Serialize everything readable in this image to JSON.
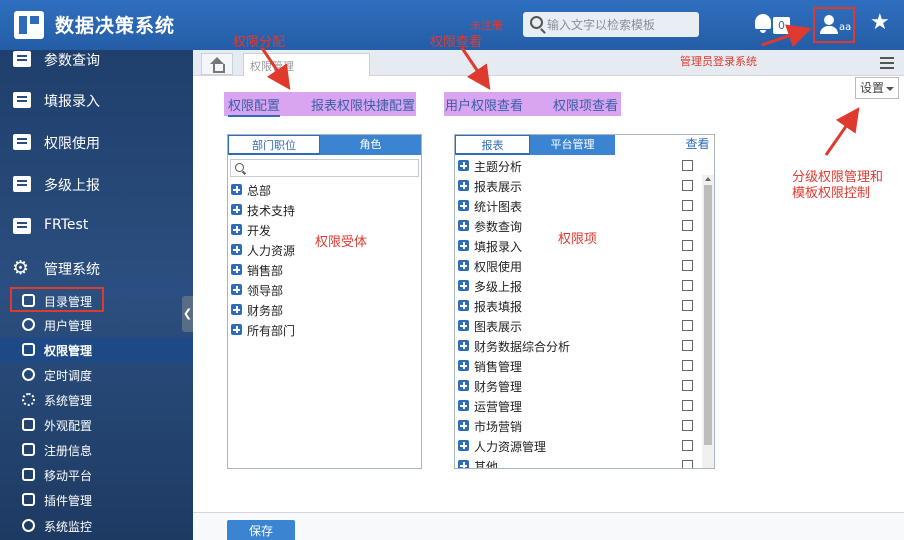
{
  "header": {
    "app_title": "数据决策系统",
    "search_placeholder": "输入文字以检索模板",
    "notification_count": "0",
    "user_name": "aa"
  },
  "sidebar": {
    "items": [
      {
        "label": "参数查询",
        "icon": "report-icon"
      },
      {
        "label": "填报录入",
        "icon": "report-icon"
      },
      {
        "label": "权限使用",
        "icon": "report-icon"
      },
      {
        "label": "多级上报",
        "icon": "report-icon"
      },
      {
        "label": "FRTest",
        "icon": "report-icon"
      },
      {
        "label": "管理系统",
        "icon": "gear-icon"
      }
    ],
    "sub_items": [
      {
        "label": "目录管理",
        "icon": "directory-icon"
      },
      {
        "label": "用户管理",
        "icon": "user-icon"
      },
      {
        "label": "权限管理",
        "icon": "lock-icon",
        "active": true
      },
      {
        "label": "定时调度",
        "icon": "clock-icon"
      },
      {
        "label": "系统管理",
        "icon": "gear-icon"
      },
      {
        "label": "外观配置",
        "icon": "palette-icon"
      },
      {
        "label": "注册信息",
        "icon": "register-icon"
      },
      {
        "label": "移动平台",
        "icon": "mobile-icon"
      },
      {
        "label": "插件管理",
        "icon": "plugin-icon"
      },
      {
        "label": "系统监控",
        "icon": "monitor-icon"
      }
    ]
  },
  "content": {
    "page_tab": "权限管理",
    "settings_label": "设置",
    "tabs_left": [
      "权限配置",
      "报表权限快捷配置"
    ],
    "tabs_right": [
      "用户权限查看",
      "权限项查看"
    ],
    "left_panel": {
      "tabs": [
        "部门职位",
        "角色"
      ],
      "items": [
        "总部",
        "技术支持",
        "开发",
        "人力资源",
        "销售部",
        "领导部",
        "财务部",
        "所有部门"
      ]
    },
    "right_panel": {
      "tabs": [
        "报表",
        "平台管理",
        "查看"
      ],
      "items": [
        "主题分析",
        "报表展示",
        "统计图表",
        "参数查询",
        "填报录入",
        "权限使用",
        "多级上报",
        "报表填报",
        "图表展示",
        "财务数据综合分析",
        "销售管理",
        "财务管理",
        "运营管理",
        "市场营销",
        "人力资源管理",
        "其他"
      ]
    },
    "save_label": "保存"
  },
  "annotations": {
    "perm_config": "权限分配",
    "perm_view": "权限查看",
    "unregistered": "未注册",
    "admin_logout": "管理员登录系统",
    "perm_subject": "权限受体",
    "perm_item": "权限项",
    "settings_note_1": "分级权限管理和",
    "settings_note_2": "模板权限控制"
  },
  "colors": {
    "header_blue": "#2f6fbe",
    "sidebar_blue": "#2b4f80",
    "accent": "#2e6cba",
    "annotation_red": "#e03a2f",
    "highlight_purple": "#d9a4f0"
  }
}
